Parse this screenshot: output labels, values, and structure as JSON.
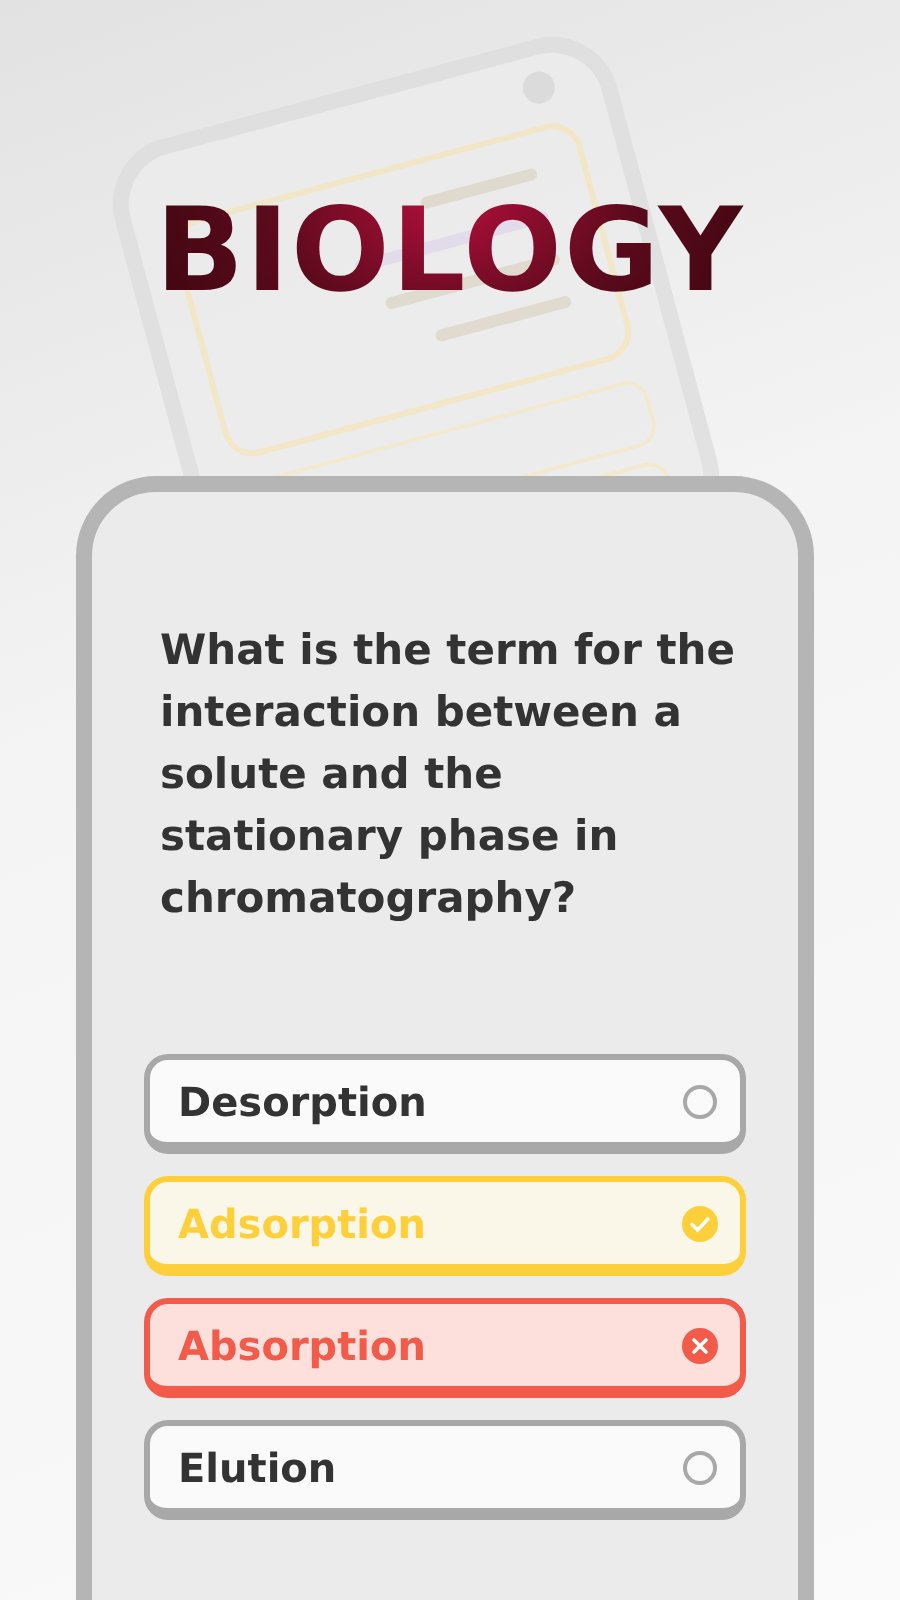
{
  "title": "BIOLOGY",
  "question": "What is the term for the interaction between a solute and the stationary phase in chromatography?",
  "options": [
    {
      "label": "Desorption",
      "kind": "neutral"
    },
    {
      "label": "Adsorption",
      "kind": "correct"
    },
    {
      "label": "Absorption",
      "kind": "wrong"
    },
    {
      "label": "Elution",
      "kind": "neutral"
    }
  ]
}
